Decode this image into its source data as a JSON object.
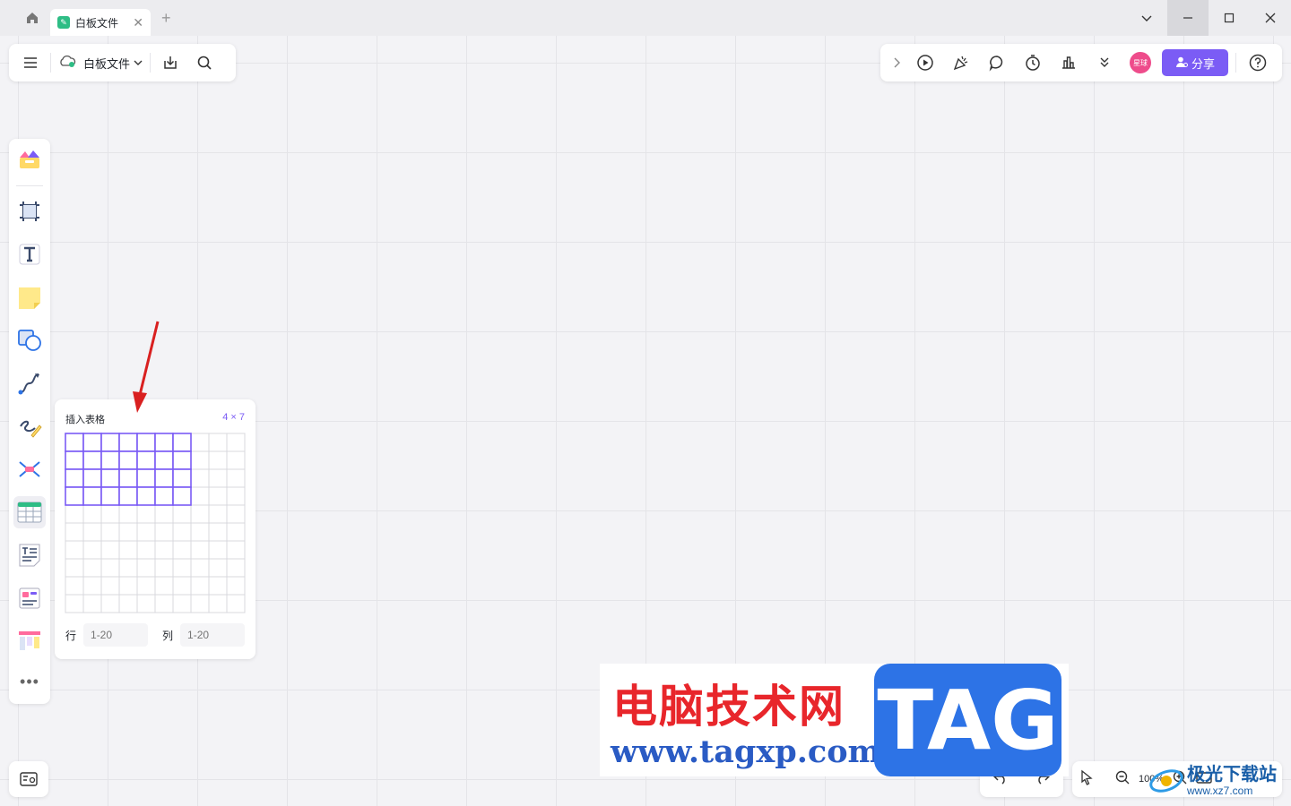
{
  "titlebar": {
    "tab_title": "白板文件",
    "new_tab_symbol": "+",
    "close_symbol": "✕"
  },
  "top_left": {
    "file_name": "白板文件"
  },
  "top_right": {
    "avatar_text": "星球",
    "share_label": "分享",
    "accent_color": "#7b5cf5"
  },
  "left_toolbar": {
    "items": [
      "templates",
      "frame",
      "text",
      "sticky-note",
      "shape",
      "connector",
      "pen",
      "mindmap",
      "table",
      "text-doc",
      "card",
      "kanban"
    ],
    "more": "•••"
  },
  "table_popup": {
    "title": "插入表格",
    "selection": "4 × 7",
    "selected_rows": 4,
    "selected_cols": 7,
    "grid_rows": 10,
    "grid_cols": 10,
    "row_label": "行",
    "col_label": "列",
    "row_placeholder": "1-20",
    "col_placeholder": "1-20"
  },
  "zoom": {
    "value": "100%"
  },
  "watermark": {
    "cn": "电脑技术网",
    "url": "www.tagxp.com",
    "tag": "TAG",
    "cn2": "极光下载站",
    "url2": "www.xz7.com"
  }
}
